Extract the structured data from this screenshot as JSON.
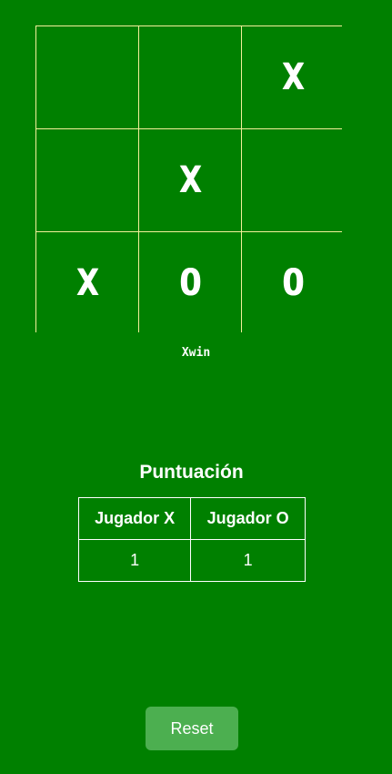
{
  "board": {
    "cells": [
      "",
      "",
      "X",
      "",
      "X",
      "",
      "X",
      "O",
      "O"
    ]
  },
  "status": "Xwin",
  "score": {
    "title": "Puntuación",
    "headers": [
      "Jugador X",
      "Jugador O"
    ],
    "values": [
      "1",
      "1"
    ]
  },
  "reset_label": "Reset",
  "colors": {
    "background": "#008000",
    "grid_line": "#f3ef9a",
    "button": "#4caf50",
    "text": "#ffffff"
  }
}
